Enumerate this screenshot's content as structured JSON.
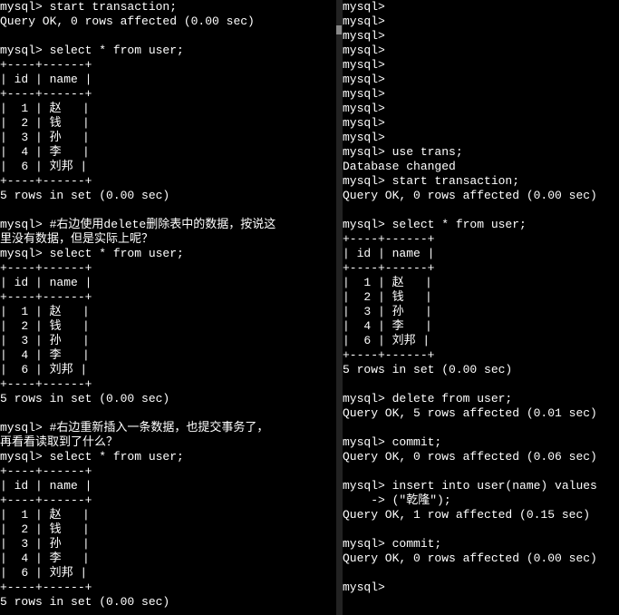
{
  "left": {
    "lines": [
      "mysql> start transaction;",
      "Query OK, 0 rows affected (0.00 sec)",
      "",
      "mysql> select * from user;",
      "+----+------+",
      "| id | name |",
      "+----+------+",
      "|  1 | 赵   |",
      "|  2 | 钱   |",
      "|  3 | 孙   |",
      "|  4 | 李   |",
      "|  6 | 刘邦 |",
      "+----+------+",
      "5 rows in set (0.00 sec)",
      "",
      "mysql> #右边使用delete删除表中的数据，按说这",
      "里没有数据，但是实际上呢？",
      "mysql> select * from user;",
      "+----+------+",
      "| id | name |",
      "+----+------+",
      "|  1 | 赵   |",
      "|  2 | 钱   |",
      "|  3 | 孙   |",
      "|  4 | 李   |",
      "|  6 | 刘邦 |",
      "+----+------+",
      "5 rows in set (0.00 sec)",
      "",
      "mysql> #右边重新插入一条数据，也提交事务了，",
      "再看看读取到了什么？",
      "mysql> select * from user;",
      "+----+------+",
      "| id | name |",
      "+----+------+",
      "|  1 | 赵   |",
      "|  2 | 钱   |",
      "|  3 | 孙   |",
      "|  4 | 李   |",
      "|  6 | 刘邦 |",
      "+----+------+",
      "5 rows in set (0.00 sec)"
    ]
  },
  "right": {
    "lines": [
      "mysql>",
      "mysql>",
      "mysql>",
      "mysql>",
      "mysql>",
      "mysql>",
      "mysql>",
      "mysql>",
      "mysql>",
      "mysql>",
      "mysql> use trans;",
      "Database changed",
      "mysql> start transaction;",
      "Query OK, 0 rows affected (0.00 sec)",
      "",
      "mysql> select * from user;",
      "+----+------+",
      "| id | name |",
      "+----+------+",
      "|  1 | 赵   |",
      "|  2 | 钱   |",
      "|  3 | 孙   |",
      "|  4 | 李   |",
      "|  6 | 刘邦 |",
      "+----+------+",
      "5 rows in set (0.00 sec)",
      "",
      "mysql> delete from user;",
      "Query OK, 5 rows affected (0.01 sec)",
      "",
      "mysql> commit;",
      "Query OK, 0 rows affected (0.06 sec)",
      "",
      "mysql> insert into user(name) values",
      "    -> (\"乾隆\");",
      "Query OK, 1 row affected (0.15 sec)",
      "",
      "mysql> commit;",
      "Query OK, 0 rows affected (0.00 sec)",
      "",
      "mysql>"
    ]
  }
}
